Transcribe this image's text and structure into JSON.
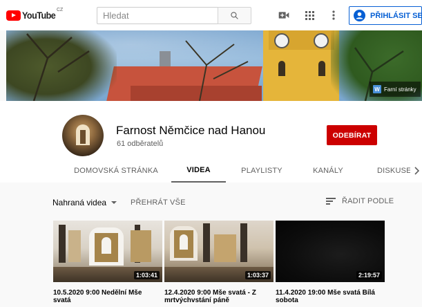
{
  "header": {
    "logo_text": "YouTube",
    "logo_country": "CZ",
    "search_placeholder": "Hledat",
    "icons": [
      "search-icon",
      "create-video-icon",
      "apps-grid-icon",
      "more-vert-icon",
      "account-icon"
    ],
    "signin_label": "PŘIHLÁSIT SE"
  },
  "banner": {
    "link_icon_letter": "W",
    "link_label": "Farní stránky"
  },
  "channel": {
    "name": "Farnost Němčice nad Hanou",
    "subscribers": "61 odběratelů",
    "subscribe_label": "ODEBÍRAT"
  },
  "tabs": [
    {
      "label": "DOMOVSKÁ STRÁNKA",
      "active": false
    },
    {
      "label": "VIDEA",
      "active": true
    },
    {
      "label": "PLAYLISTY",
      "active": false
    },
    {
      "label": "KANÁLY",
      "active": false
    },
    {
      "label": "DISKUSE",
      "active": false
    }
  ],
  "content": {
    "section_label": "Nahraná videa",
    "play_all_label": "PŘEHRÁT VŠE",
    "sort_label": "ŘADIT PODLE"
  },
  "videos": [
    {
      "title": "10.5.2020 9:00 Nedělní Mše svatá",
      "duration": "1:03:41"
    },
    {
      "title": "12.4.2020 9:00 Mše svatá - Z mrtvýchvstání páně",
      "duration": "1:03:37"
    },
    {
      "title": "11.4.2020 19:00 Mše svatá Bílá sobota",
      "duration": "2:19:57"
    }
  ],
  "colors": {
    "brand_red": "#ff0000",
    "subscribe_red": "#cc0000",
    "link_blue": "#065fd4"
  }
}
